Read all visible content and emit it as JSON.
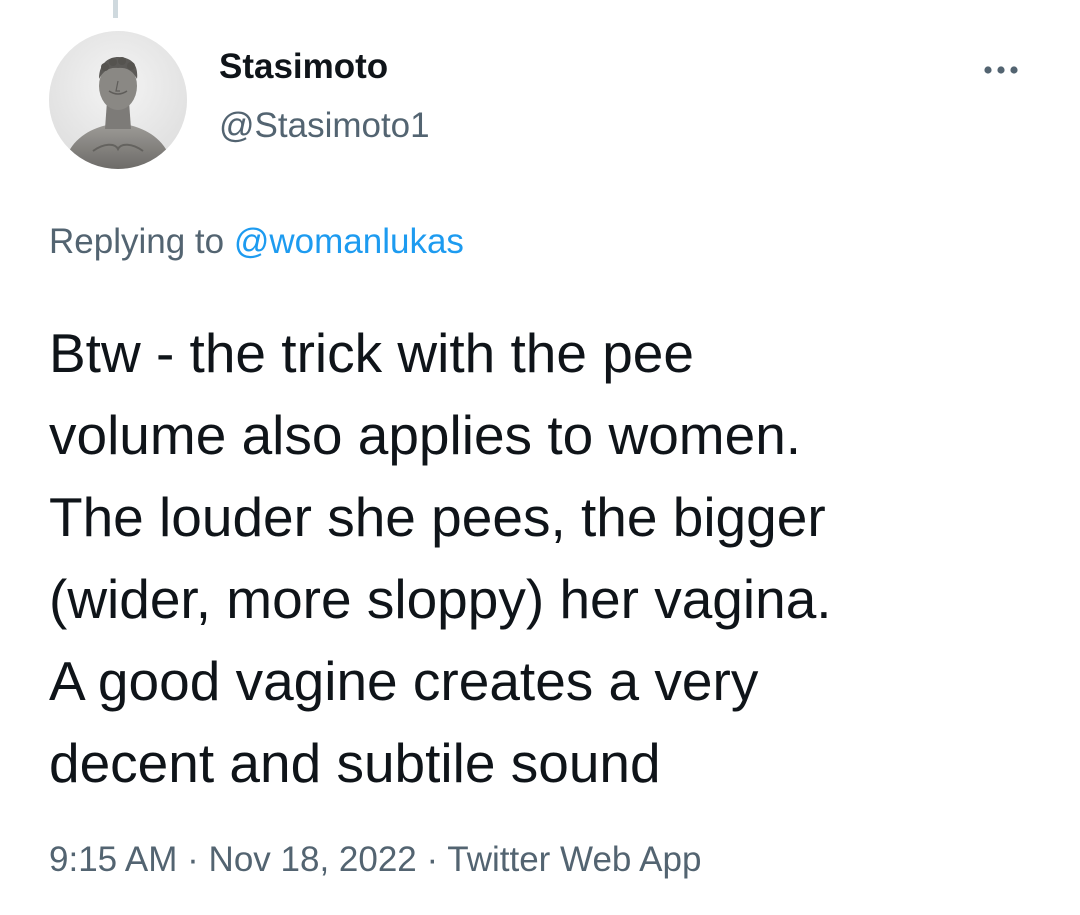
{
  "tweet": {
    "author": {
      "display_name": "Stasimoto",
      "handle": "@Stasimoto1"
    },
    "more_icon": "more-horizontal-icon",
    "reply": {
      "prefix": "Replying to",
      "mention": "@womanlukas"
    },
    "text_lines": [
      "Btw - the trick with the pee",
      "volume also applies to women.",
      "The louder she pees, the bigger",
      "(wider, more sloppy) her vagina.",
      "A good vagine creates a very",
      "decent and subtile sound"
    ],
    "meta": {
      "time": "9:15 AM",
      "separator": "·",
      "date": "Nov 18, 2022",
      "source": "Twitter Web App"
    }
  },
  "colors": {
    "text_primary": "#0f1419",
    "text_secondary": "#536471",
    "link": "#1d9bf0",
    "thread_line": "#cfd9de"
  }
}
